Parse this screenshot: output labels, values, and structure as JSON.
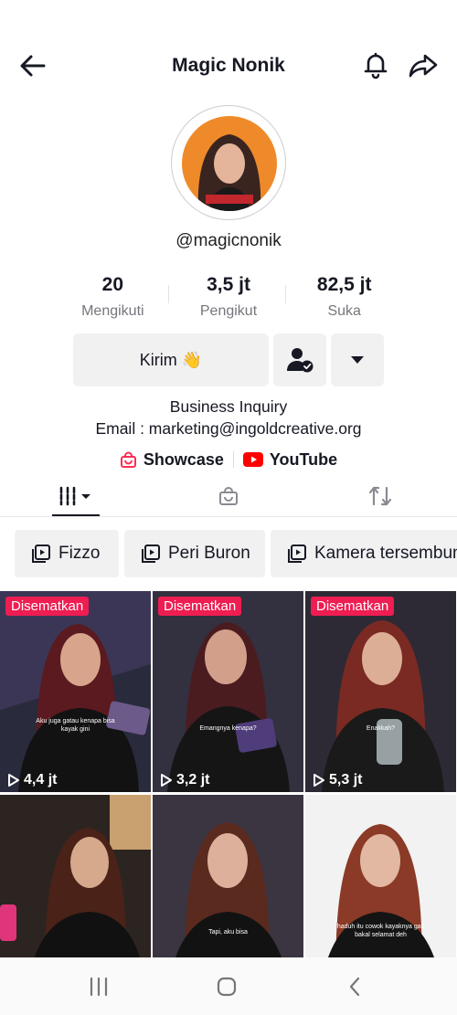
{
  "header": {
    "title": "Magic Nonik"
  },
  "profile": {
    "handle": "@magicnonik",
    "avatar_badge": "MAGIC NONIK"
  },
  "stats": [
    {
      "value": "20",
      "label": "Mengikuti"
    },
    {
      "value": "3,5 jt",
      "label": "Pengikut"
    },
    {
      "value": "82,5 jt",
      "label": "Suka"
    }
  ],
  "actions": {
    "message_label": "Kirim 👋"
  },
  "bio": {
    "line1": "Business Inquiry",
    "line2": "Email : marketing@ingoldcreative.org"
  },
  "links": {
    "showcase": "Showcase",
    "youtube": "YouTube"
  },
  "playlists": [
    {
      "label": "Fizzo"
    },
    {
      "label": "Peri Buron"
    },
    {
      "label": "Kamera tersembunyi"
    }
  ],
  "videos": [
    {
      "pinned": "Disematkan",
      "views": "4,4 jt",
      "caption": "Aku juga gatau kenapa bisa kayak gini"
    },
    {
      "pinned": "Disematkan",
      "views": "3,2 jt",
      "caption": "Emangnya kenapa?"
    },
    {
      "pinned": "Disematkan",
      "views": "5,3 jt",
      "caption": "Enakkah?"
    },
    {
      "caption": ""
    },
    {
      "caption": "Tapi, aku bisa"
    },
    {
      "caption": "haduh itu cowok kayaknya gak bakal selamat deh"
    }
  ],
  "colors": {
    "pinned": "#ee1d52",
    "youtube": "#ff0000",
    "showcase": "#fe2c55",
    "avatar_bg": "#ef8a2a"
  }
}
